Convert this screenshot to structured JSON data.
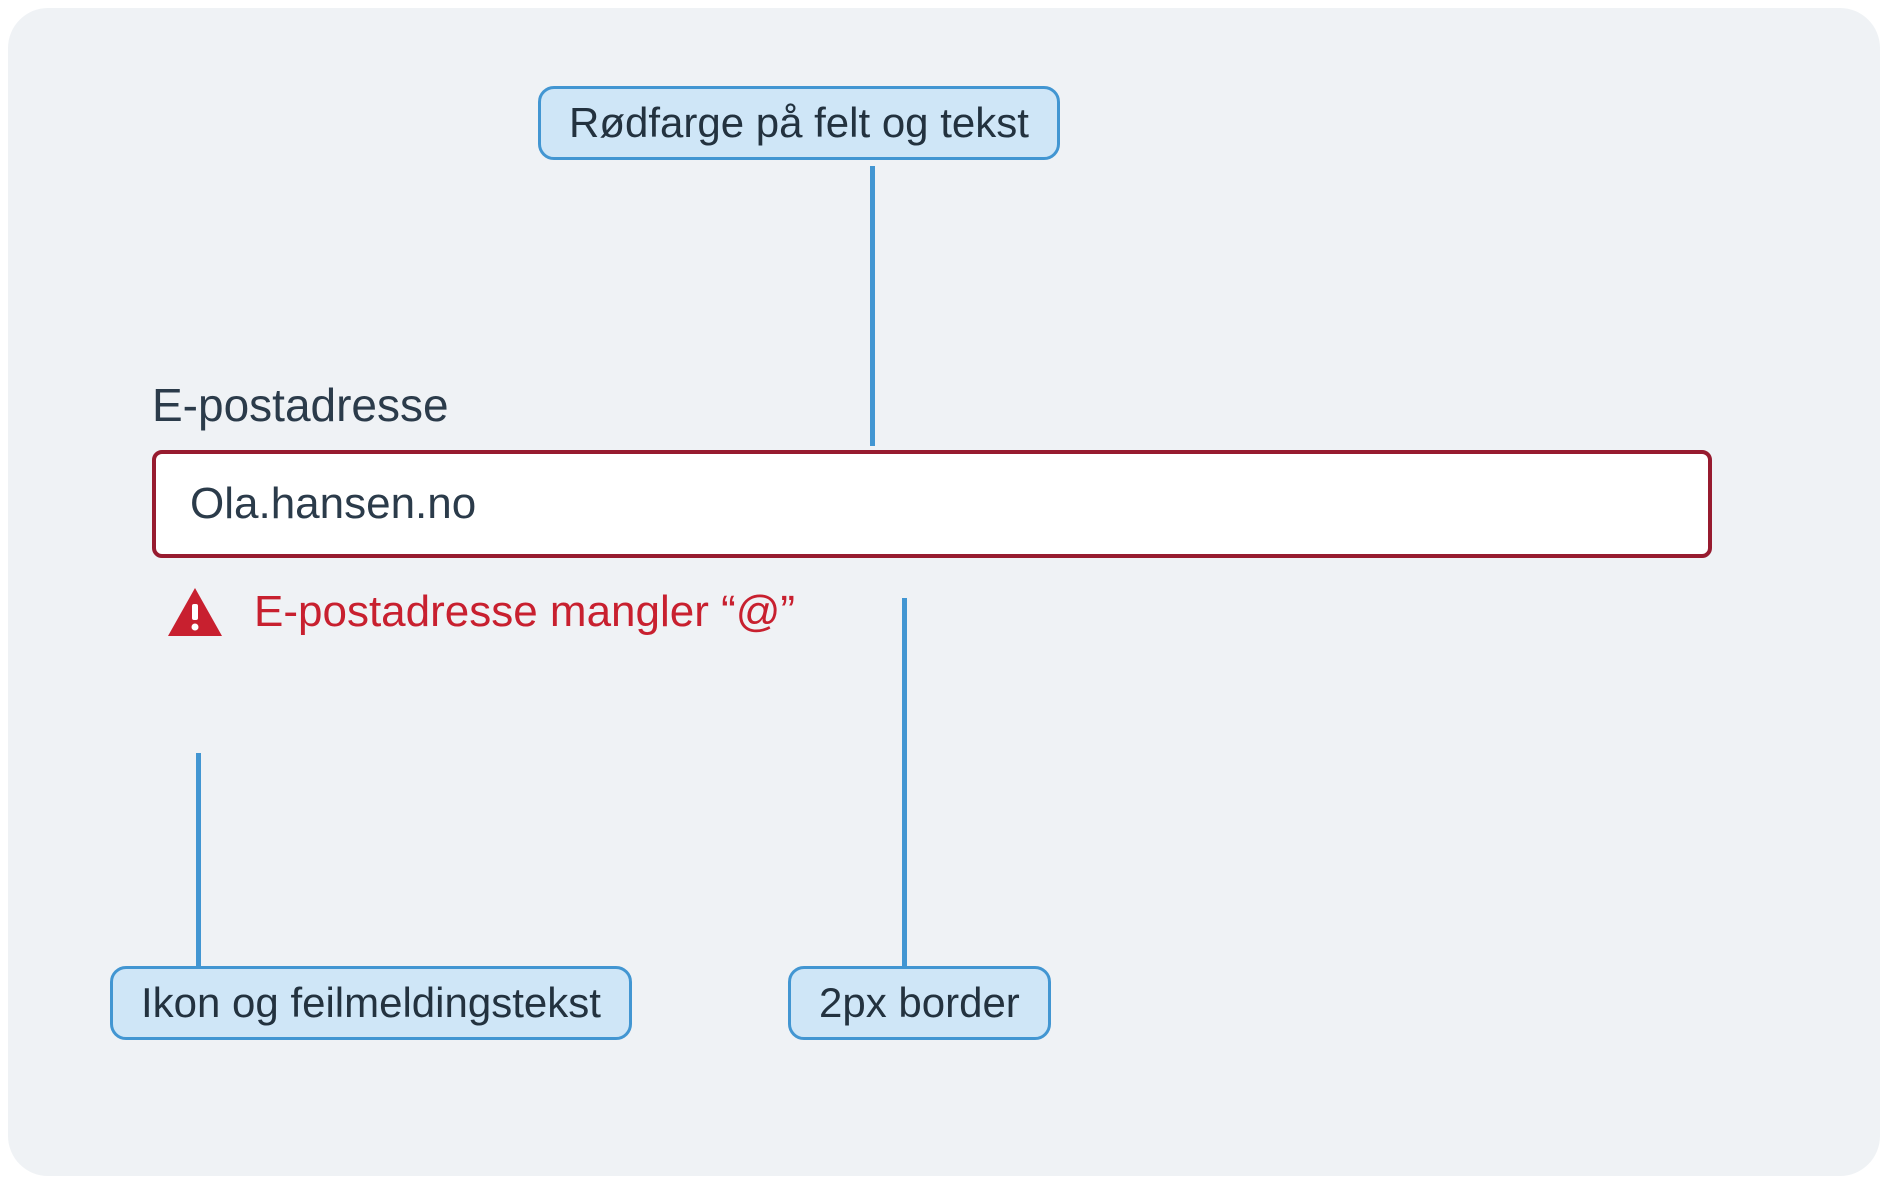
{
  "callouts": {
    "top": "Rødfarge på felt og tekst",
    "bottom_left": "Ikon og feilmeldingstekst",
    "bottom_right": "2px border"
  },
  "field": {
    "label": "E-postadresse",
    "value": "Ola.hansen.no",
    "error_message": "E-postadresse mangler “@”"
  },
  "colors": {
    "callout_fill": "#CFE6F7",
    "callout_border": "#4296D2",
    "error_border": "#971B2F",
    "error_text": "#C8202F",
    "bg": "#EFF2F5",
    "text": "#2B3B4A"
  }
}
